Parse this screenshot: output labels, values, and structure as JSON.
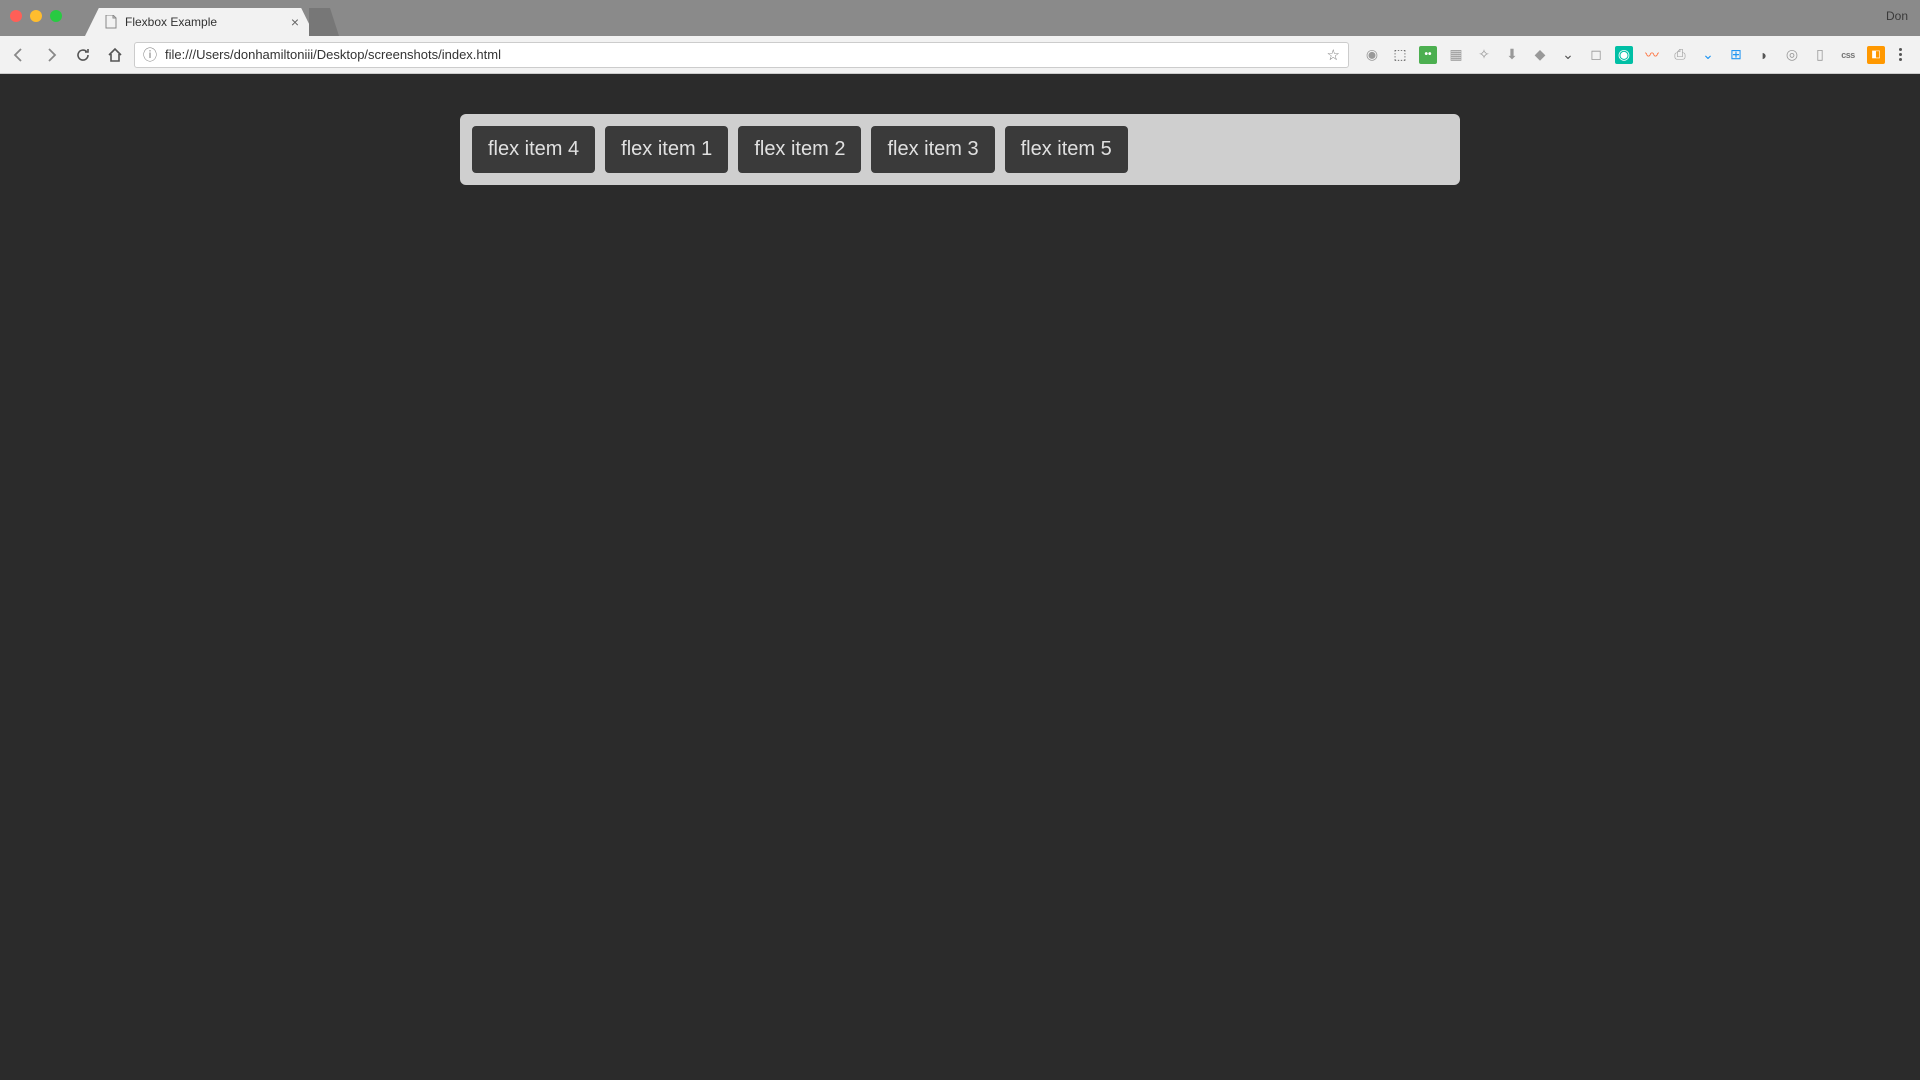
{
  "browser": {
    "tab": {
      "title": "Flexbox Example"
    },
    "user": "Don",
    "url": "file:///Users/donhamiltoniii/Desktop/screenshots/index.html",
    "extensions": {
      "css_label": "css"
    }
  },
  "page": {
    "flex_items": [
      "flex item 4",
      "flex item 1",
      "flex item 2",
      "flex item 3",
      "flex item 5"
    ]
  },
  "colors": {
    "page_bg": "#2b2b2b",
    "container_bg": "#cfcfcf",
    "item_bg": "#3a3a3a",
    "item_fg": "#e0e0e0"
  }
}
